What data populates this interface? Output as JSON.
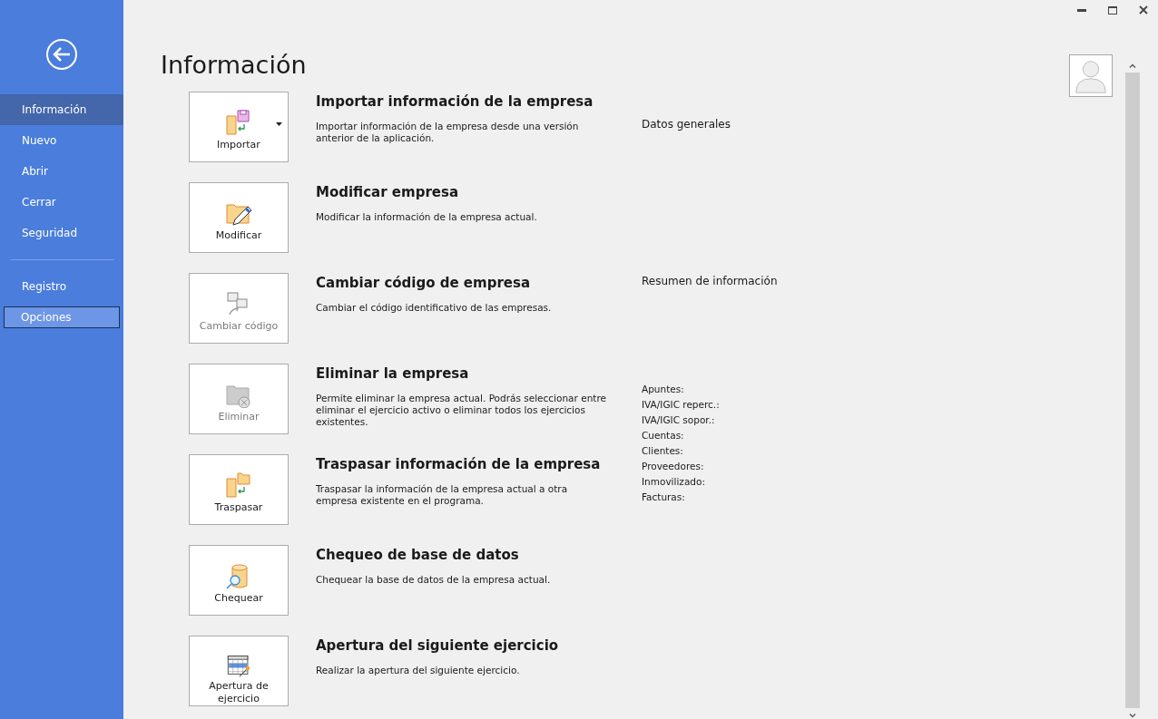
{
  "sidebar": {
    "items": [
      {
        "label": "Información",
        "selected": true,
        "focused": false
      },
      {
        "label": "Nuevo",
        "selected": false,
        "focused": false
      },
      {
        "label": "Abrir",
        "selected": false,
        "focused": false
      },
      {
        "label": "Cerrar",
        "selected": false,
        "focused": false
      },
      {
        "label": "Seguridad",
        "selected": false,
        "focused": false
      },
      {
        "kind": "divider"
      },
      {
        "label": "Registro",
        "selected": false,
        "focused": false
      },
      {
        "label": "Opciones",
        "selected": false,
        "focused": true
      }
    ]
  },
  "page_title": "Información",
  "actions": [
    {
      "kind": "import",
      "button": "Importar",
      "disabled": false,
      "dropdown": true,
      "title": "Importar información de la empresa",
      "description": "Importar información de la empresa desde una versión anterior de la aplicación."
    },
    {
      "kind": "edit",
      "button": "Modificar",
      "disabled": false,
      "dropdown": false,
      "title": "Modificar empresa",
      "description": "Modificar la información de la empresa actual."
    },
    {
      "kind": "code",
      "button": "Cambiar código",
      "disabled": true,
      "dropdown": false,
      "title": "Cambiar código de empresa",
      "description": "Cambiar el código identificativo de las empresas."
    },
    {
      "kind": "delete",
      "button": "Eliminar",
      "disabled": true,
      "dropdown": false,
      "title": "Eliminar la empresa",
      "description": "Permite eliminar la empresa actual. Podrás seleccionar entre eliminar el ejercicio activo o eliminar todos los ejercicios existentes."
    },
    {
      "kind": "transfer",
      "button": "Traspasar",
      "disabled": false,
      "dropdown": false,
      "title": "Traspasar información de la empresa",
      "description": "Traspasar la información de la empresa actual a otra empresa existente en el programa."
    },
    {
      "kind": "check",
      "button": "Chequear",
      "disabled": false,
      "dropdown": false,
      "title": "Chequeo de base de datos",
      "description": "Chequear la base de datos de la empresa actual."
    },
    {
      "kind": "calendar",
      "button": "Apertura de ejercicio",
      "disabled": false,
      "dropdown": false,
      "title": "Apertura del siguiente ejercicio",
      "description": "Realizar la apertura del siguiente ejercicio."
    }
  ],
  "info_panel": {
    "general_heading": "Datos generales",
    "summary_heading": "Resumen de información",
    "summary_fields": [
      "Apuntes:",
      "IVA/IGIC reperc.:",
      "IVA/IGIC sopor.:",
      "Cuentas:",
      "Clientes:",
      "Proveedores:",
      "Inmovilizado:",
      "Facturas:"
    ]
  }
}
